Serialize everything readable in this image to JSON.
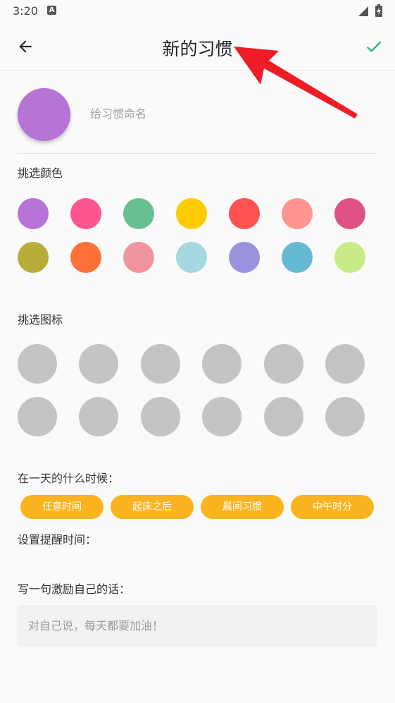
{
  "status_bar": {
    "time": "3:20",
    "notification_letter": "A"
  },
  "app_bar": {
    "title": "新的习惯",
    "back_icon": "arrow-left-icon",
    "confirm_icon": "check-icon"
  },
  "habit": {
    "avatar_color": "#b574d6",
    "name_placeholder": "给习惯命名"
  },
  "color_section": {
    "label": "挑选颜色",
    "colors": [
      "#b574d6",
      "#ff5591",
      "#67c08f",
      "#ffcc00",
      "#ff5252",
      "#ff9491",
      "#e05286",
      "#b7ad38",
      "#ff7138",
      "#f1959d",
      "#a5d8e0",
      "#9b92df",
      "#65b9d3",
      "#c8ec87"
    ]
  },
  "icon_section": {
    "label": "挑选图标",
    "slot_color": "#c4c4c4",
    "slot_count": 12
  },
  "time_section": {
    "label": "在一天的什么时候：",
    "chips": [
      "任意时间",
      "起床之后",
      "晨间习惯",
      "中午时分"
    ],
    "chip_color": "#fbb320"
  },
  "reminder": {
    "label": "设置提醒时间："
  },
  "motto": {
    "label": "写一句激励自己的话：",
    "placeholder": "对自己说，每天都要加油！"
  },
  "accent": {
    "confirm": "#2bb673",
    "annotation_arrow": "#ee1c25"
  }
}
